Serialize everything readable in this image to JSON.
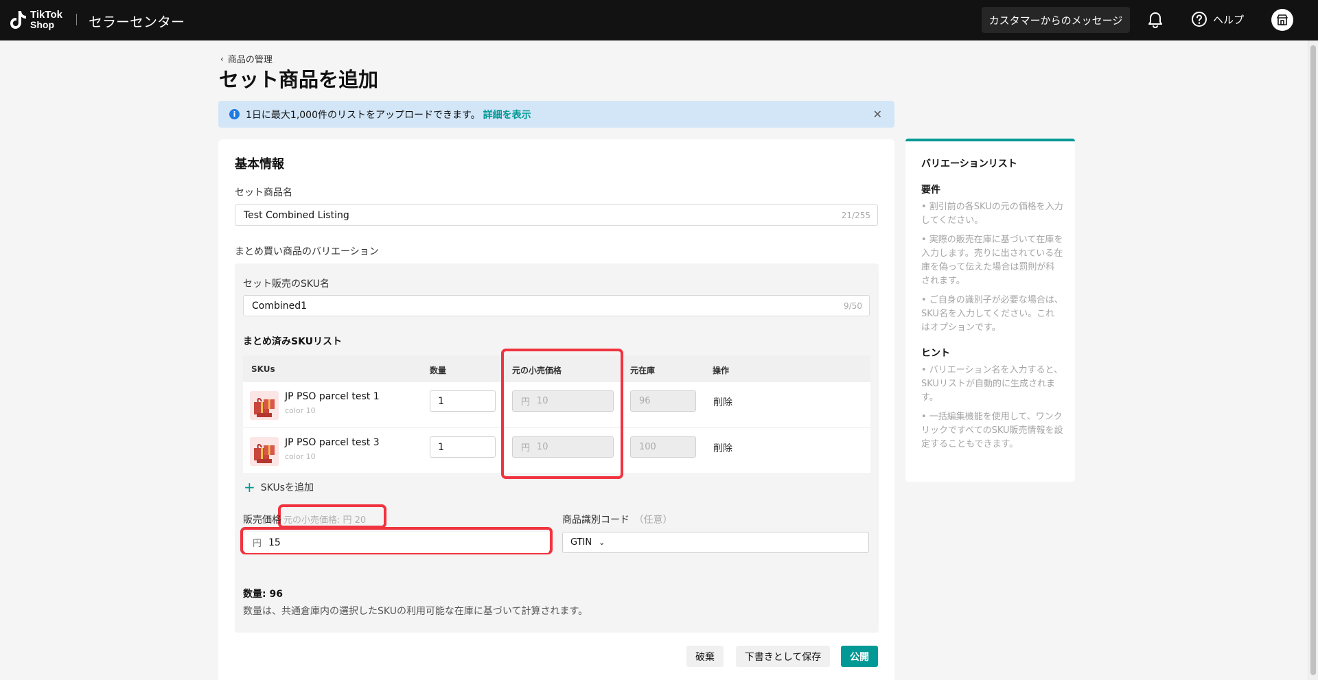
{
  "topbar": {
    "logo_line1": "TikTok",
    "logo_line2": "Shop",
    "title": "セラーセンター",
    "messages_button": "カスタマーからのメッセージ",
    "help_label": "ヘルプ"
  },
  "breadcrumb": "商品の管理",
  "page_title": "セット商品を追加",
  "banner": {
    "text": "1日に最大1,000件のリストをアップロードできます。",
    "link": "詳細を表示"
  },
  "basic_info": {
    "title": "基本情報",
    "name_label": "セット商品名",
    "name_value": "Test Combined Listing",
    "name_counter": "21/255",
    "variation_label": "まとめ買い商品のバリエーション"
  },
  "variation": {
    "sku_name_label": "セット販売のSKU名",
    "sku_name_value": "Combined1",
    "sku_name_counter": "9/50",
    "list_title": "まとめ済みSKUリスト",
    "columns": {
      "skus": "SKUs",
      "qty": "数量",
      "retail_price": "元の小売価格",
      "stock": "元在庫",
      "actions": "操作"
    },
    "rows": [
      {
        "name": "JP PSO parcel test 1",
        "sub": "color 10",
        "qty": "1",
        "price_currency": "円",
        "price": "10",
        "stock": "96",
        "action": "削除"
      },
      {
        "name": "JP PSO parcel test 3",
        "sub": "color 10",
        "qty": "1",
        "price_currency": "円",
        "price": "10",
        "stock": "100",
        "action": "削除"
      }
    ],
    "add_sku": "SKUsを追加",
    "price_label": "販売価格",
    "price_hint": "元の小売価格: 円 20",
    "price_currency": "円",
    "price_value": "15",
    "id_code_label": "商品識別コード",
    "id_code_optional": "（任意）",
    "id_code_type": "GTIN",
    "quantity_label": "数量: 96",
    "quantity_note": "数量は、共通倉庫内の選択したSKUの利用可能な在庫に基づいて計算されます。"
  },
  "actions": {
    "discard": "破棄",
    "save_draft": "下書きとして保存",
    "publish": "公開"
  },
  "side_panel": {
    "title": "バリエーションリスト",
    "requirements_title": "要件",
    "requirements": [
      "• 割引前の各SKUの元の価格を入力してください。",
      "• 実際の販売在庫に基づいて在庫を入力します。売りに出されている在庫を偽って伝えた場合は罰則が科されます。",
      "• ご自身の識別子が必要な場合は、SKU名を入力してください。これはオプションです。"
    ],
    "hints_title": "ヒント",
    "hints": [
      "• バリエーション名を入力すると、SKUリストが自動的に生成されます。",
      "• 一括編集機能を使用して、ワンクリックですべてのSKU販売情報を設定することもできます。"
    ]
  },
  "colors": {
    "accent": "#009995",
    "highlight": "#f0343f",
    "topbar": "#121212",
    "banner": "#d3e6f8"
  }
}
